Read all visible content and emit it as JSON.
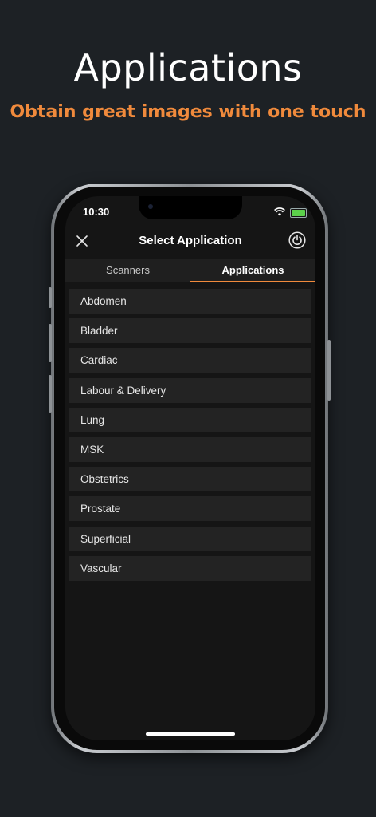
{
  "hero": {
    "title": "Applications",
    "subtitle": "Obtain great images with one touch"
  },
  "status_bar": {
    "time": "10:30",
    "icons": [
      "wifi-icon",
      "battery-icon"
    ]
  },
  "nav": {
    "title": "Select Application",
    "left_icon": "close-icon",
    "right_icon": "power-icon"
  },
  "tabs": [
    {
      "label": "Scanners",
      "selected": false
    },
    {
      "label": "Applications",
      "selected": true
    }
  ],
  "applications": [
    {
      "label": "Abdomen"
    },
    {
      "label": "Bladder"
    },
    {
      "label": "Cardiac"
    },
    {
      "label": "Labour & Delivery"
    },
    {
      "label": "Lung"
    },
    {
      "label": "MSK"
    },
    {
      "label": "Obstetrics"
    },
    {
      "label": "Prostate"
    },
    {
      "label": "Superficial"
    },
    {
      "label": "Vascular"
    }
  ],
  "colors": {
    "background": "#1d2125",
    "accent": "#f08a3c",
    "screen": "#151515",
    "list_item": "#232323",
    "battery": "#5bd04a"
  }
}
